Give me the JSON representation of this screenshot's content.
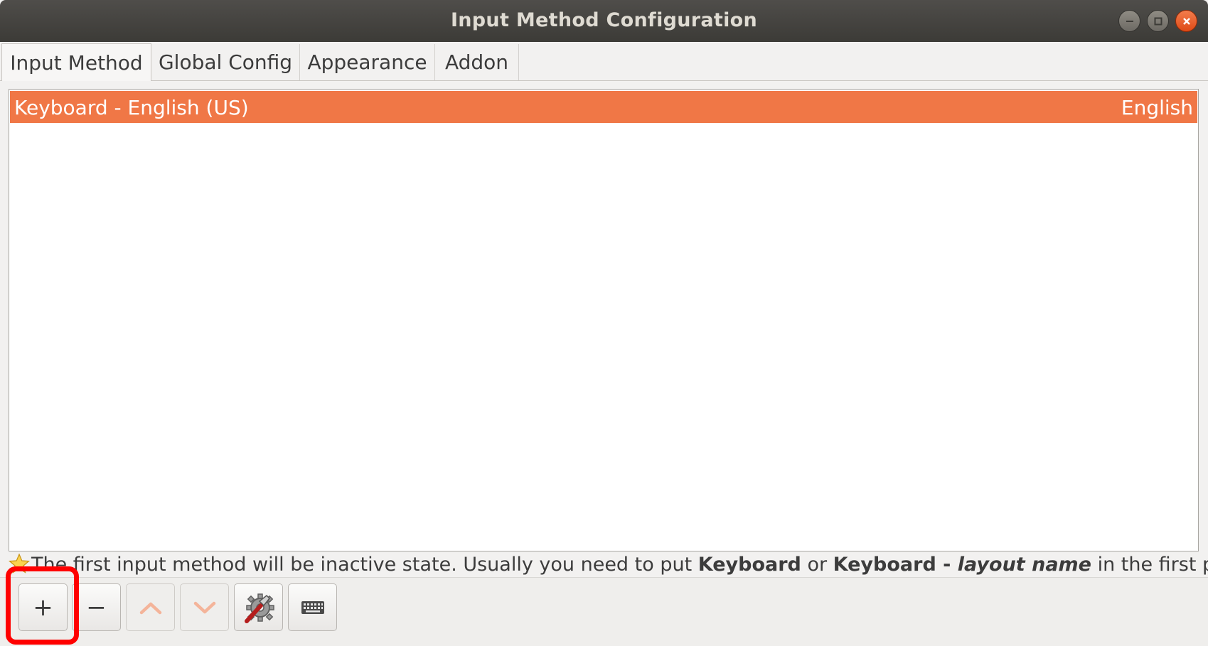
{
  "window": {
    "title": "Input Method Configuration"
  },
  "tabs": [
    {
      "label": "Input Method",
      "active": true
    },
    {
      "label": "Global Config",
      "active": false
    },
    {
      "label": "Appearance",
      "active": false
    },
    {
      "label": "Addon",
      "active": false
    }
  ],
  "input_methods": [
    {
      "name": "Keyboard - English (US)",
      "language": "English",
      "selected": true
    }
  ],
  "hint": {
    "icon": "star-icon",
    "prefix": "The first input method will be inactive state. Usually you need to put ",
    "bold1": "Keyboard",
    "middle": " or ",
    "bold2": "Keyboard - ",
    "italic": "layout name",
    "suffix": " in the first place."
  },
  "toolbar": {
    "add_label": "+",
    "remove_label": "−",
    "buttons": [
      "add",
      "remove",
      "move-up",
      "move-down",
      "configure",
      "keyboard-layout"
    ]
  },
  "colors": {
    "selection": "#f07746",
    "highlight_annotation": "#ff0000",
    "titlebar": "#3c3b37"
  }
}
